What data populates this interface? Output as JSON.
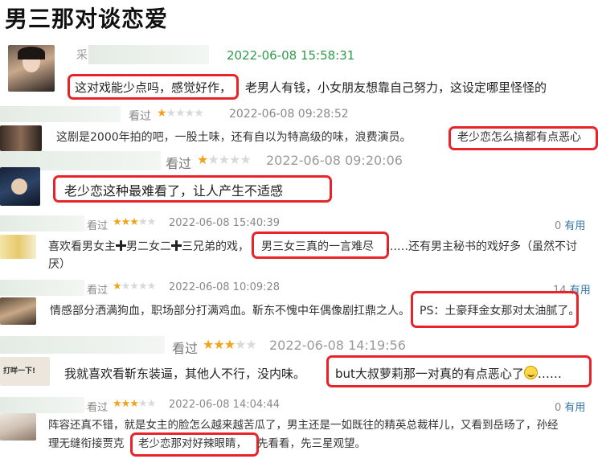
{
  "page": {
    "title": "男三那对谈恋爱"
  },
  "reviews": [
    {
      "name_fragment": "采",
      "rating_label": "",
      "timestamp": "2022-06-08 15:58:31",
      "highlight": "这对戏能少点吗，感觉好作，",
      "text": "老男人有钱，小女朋友想靠自己努力，这设定哪里怪怪的"
    },
    {
      "rating_label": "看过",
      "stars": 1,
      "timestamp": "2022-06-08 09:28:52",
      "text": "这剧是2000年拍的吧，一股土味，还有自以为特高级的味，浪费演员。",
      "highlight": "老少恋怎么搞都有点恶心"
    },
    {
      "rating_label": "看过",
      "stars": 1,
      "timestamp": "2022-06-08 09:20:06",
      "highlight": "老少恋这种最难看了，让人产生不适感"
    },
    {
      "rating_label": "看过",
      "stars": 3,
      "timestamp": "2022-06-08 15:40:39",
      "useful_count": "0",
      "useful_label": "有用",
      "text_a": "喜欢看男女主",
      "text_b": "男二女二",
      "text_c": "三兄弟的戏，",
      "highlight": "男三女三真的一言难尽",
      "text_d": "……还有男主秘书的戏好多（虽然不讨",
      "text_line2": "厌）"
    },
    {
      "rating_label": "看过",
      "stars": 1,
      "timestamp": "2022-06-08 10:09:28",
      "useful_count": "14",
      "useful_label": "有用",
      "text": "情感部分洒满狗血，职场部分打满鸡血。靳东不愧中年偶像剧扛鼎之人。",
      "highlight": "PS：土豪拜金女那对太油腻了。"
    },
    {
      "rating_label": "看过",
      "stars": 3,
      "timestamp": "2022-06-08 14:19:56",
      "avatar_text": "打咩一下!",
      "text": "我就喜欢看靳东装逼，其他人不行，没内味。",
      "highlight": "but大叔萝莉那一对真的有点恶心了",
      "tail": "……"
    },
    {
      "rating_label": "看过",
      "stars": 3,
      "timestamp": "2022-06-08 14:04:44",
      "useful_count": "0",
      "useful_label": "有用",
      "text_line1": "阵容还真不错，就是女主的脸怎么越来越苦瓜了，男主还是一如既往的精英总裁样儿，又看到岳旸了，孙经",
      "text_line2_pre": "理无缝衔接贾克",
      "highlight": "老少恋那对好辣眼睛，",
      "text_line2_post": "先看看，先三星观望。"
    }
  ],
  "colors": {
    "highlight_border": "#e8232a",
    "star": "#f3a21b",
    "timestamp_green": "#2e9b48",
    "link": "#3377aa"
  }
}
